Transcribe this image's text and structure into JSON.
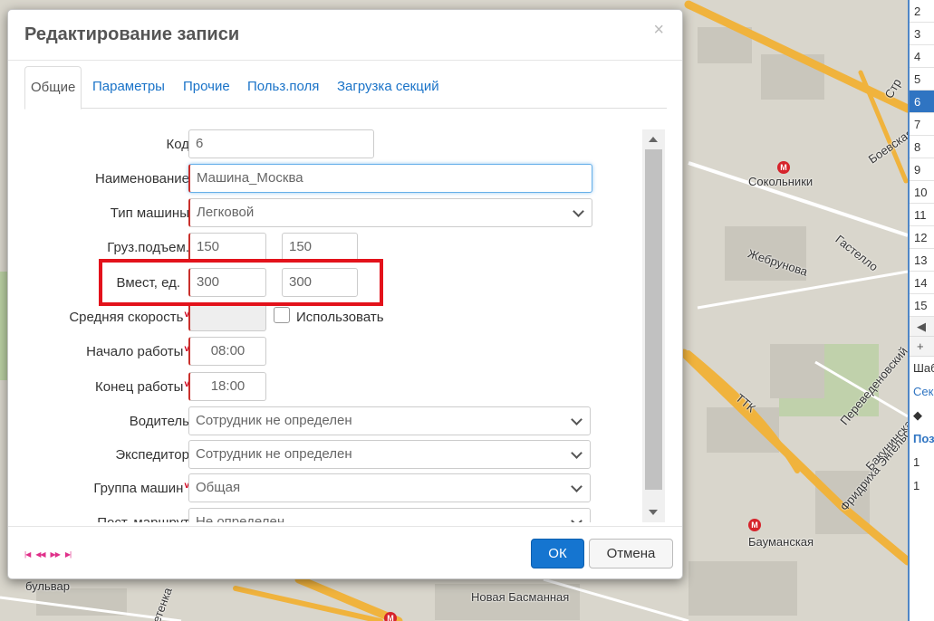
{
  "dialog": {
    "title": "Редактирование записи",
    "close_icon": "×",
    "tabs": [
      {
        "label": "Общие",
        "active": true
      },
      {
        "label": "Параметры"
      },
      {
        "label": "Прочие"
      },
      {
        "label": "Польз.поля"
      },
      {
        "label": "Загрузка секций"
      }
    ],
    "fields": {
      "code": {
        "label": "Код",
        "value": "6"
      },
      "name": {
        "label": "Наименование",
        "value": "Машина_Москва"
      },
      "vehicle_type": {
        "label": "Тип машины",
        "value": "Легковой"
      },
      "capacity": {
        "label": "Груз.подъем.",
        "value1": "150",
        "value2": "150"
      },
      "volume": {
        "label": "Вмест, ед.",
        "value1": "300",
        "value2": "300"
      },
      "avg_speed": {
        "label": "Средняя скорость",
        "required": "v",
        "checkbox_label": "Использовать"
      },
      "start_time": {
        "label": "Начало работы",
        "required": "v",
        "value": "08:00"
      },
      "end_time": {
        "label": "Конец работы",
        "required": "v",
        "value": "18:00"
      },
      "driver": {
        "label": "Водитель",
        "value": "Сотрудник не определен"
      },
      "forwarder": {
        "label": "Экспедитор",
        "value": "Сотрудник не определен"
      },
      "group": {
        "label": "Группа машин",
        "required": "v",
        "value": "Общая"
      },
      "route": {
        "label": "Пост. маршрут",
        "value": "Не определен"
      }
    },
    "pager": [
      "|◀",
      "◀◀",
      "▶▶",
      "▶|"
    ],
    "ok_label": "ОК",
    "cancel_label": "Отмена"
  },
  "map": {
    "labels": [
      "Сокольники",
      "Жебрунова",
      "Гастелло",
      "ТТК",
      "Бауманская",
      "Новая Басманная",
      "бульвар",
      "етенка",
      "Боевская",
      "Переведеновский",
      "Бакунинская",
      "Фридриха Энгельса",
      "Стр"
    ],
    "metro_icon": "М",
    "colors": {
      "road": "#f0b33d",
      "land": "#d9d6cc",
      "block": "#c9c6bc",
      "park": "#b9cfa2"
    }
  },
  "side_panel": {
    "rows": [
      "2",
      "3",
      "4",
      "5",
      "6",
      "7",
      "8",
      "9",
      "10",
      "11",
      "12",
      "13",
      "14",
      "15"
    ],
    "selected": "6",
    "tools": [
      "◀",
      "+"
    ],
    "texts": [
      "Шаб",
      "Сек",
      "Поз",
      "1",
      "1"
    ]
  },
  "colors": {
    "accent": "#1575d0",
    "highlight": "#e3121b",
    "required": "#c9302c"
  }
}
